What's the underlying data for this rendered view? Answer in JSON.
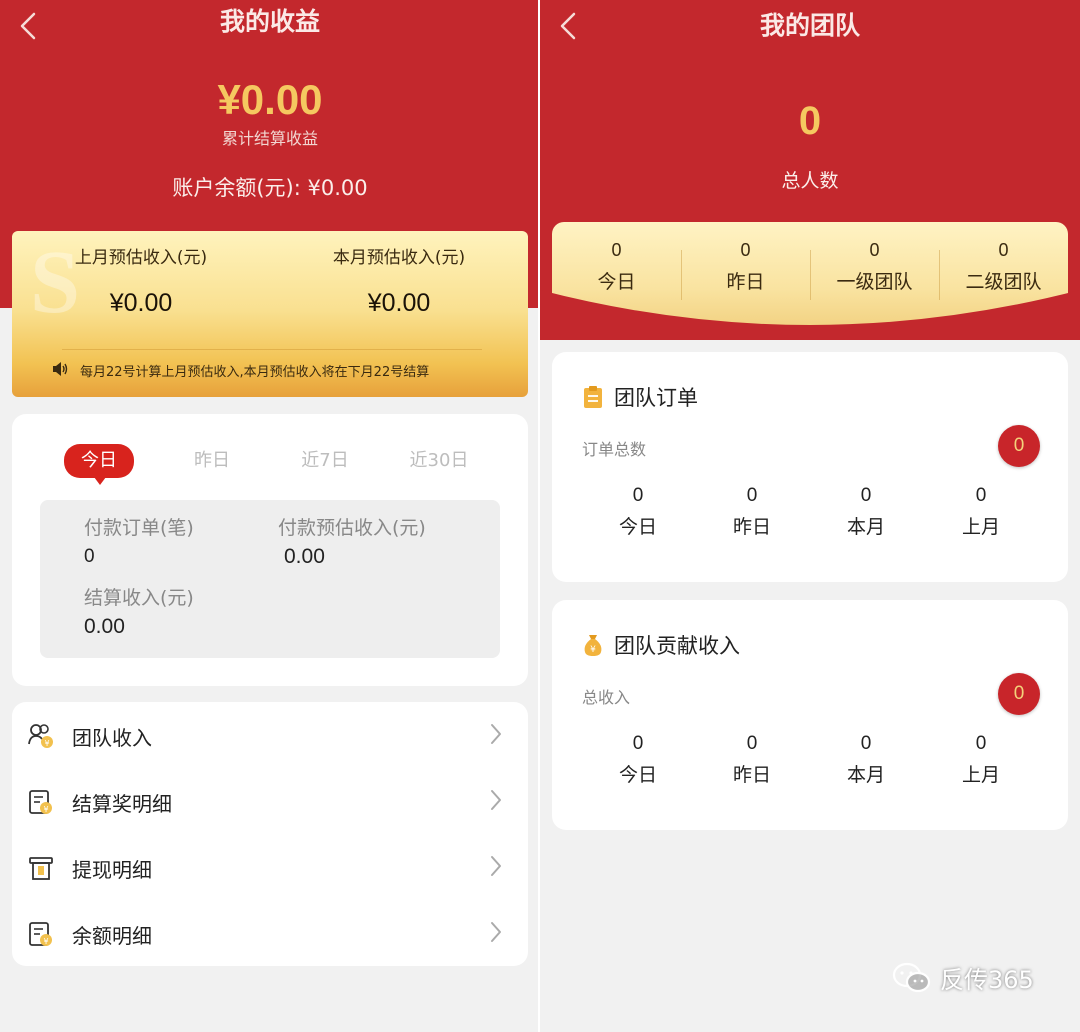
{
  "earnings": {
    "title": "我的收益",
    "total_amount": "¥0.00",
    "total_caption": "累计结算收益",
    "balance": "账户余额(元): ¥0.00",
    "last_month_label": "上月预估收入(元)",
    "last_month_value": "¥0.00",
    "this_month_label": "本月预估收入(元)",
    "this_month_value": "¥0.00",
    "notice": "每月22号计算上月预估收入,本月预估收入将在下月22号结算",
    "tabs": [
      "今日",
      "昨日",
      "近7日",
      "近30日"
    ],
    "active_tab": "今日",
    "stats": {
      "paid_orders_label": "付款订单(笔)",
      "paid_orders_value": "0",
      "paid_income_label": "付款预估收入(元)",
      "paid_income_value": "0.00",
      "settled_income_label": "结算收入(元)",
      "settled_income_value": "0.00"
    },
    "menu": [
      {
        "label": "团队收入",
        "icon": "team-income-icon"
      },
      {
        "label": "结算奖明细",
        "icon": "settlement-detail-icon"
      },
      {
        "label": "提现明细",
        "icon": "withdraw-detail-icon"
      },
      {
        "label": "余额明细",
        "icon": "balance-detail-icon"
      }
    ]
  },
  "team": {
    "title": "我的团队",
    "total_count": "0",
    "total_caption": "总人数",
    "summary": [
      {
        "value": "0",
        "label": "今日"
      },
      {
        "value": "0",
        "label": "昨日"
      },
      {
        "value": "0",
        "label": "一级团队"
      },
      {
        "value": "0",
        "label": "二级团队"
      }
    ],
    "orders": {
      "title": "团队订单",
      "sub": "订单总数",
      "badge": "0",
      "cols": [
        {
          "value": "0",
          "label": "今日"
        },
        {
          "value": "0",
          "label": "昨日"
        },
        {
          "value": "0",
          "label": "本月"
        },
        {
          "value": "0",
          "label": "上月"
        }
      ]
    },
    "contribution": {
      "title": "团队贡献收入",
      "sub": "总收入",
      "badge": "0",
      "cols": [
        {
          "value": "0",
          "label": "今日"
        },
        {
          "value": "0",
          "label": "昨日"
        },
        {
          "value": "0",
          "label": "本月"
        },
        {
          "value": "0",
          "label": "上月"
        }
      ]
    }
  },
  "watermark": "反传365",
  "colors": {
    "brand_red": "#c3282d",
    "gold": "#f5c860",
    "tab_red": "#d8231d"
  }
}
